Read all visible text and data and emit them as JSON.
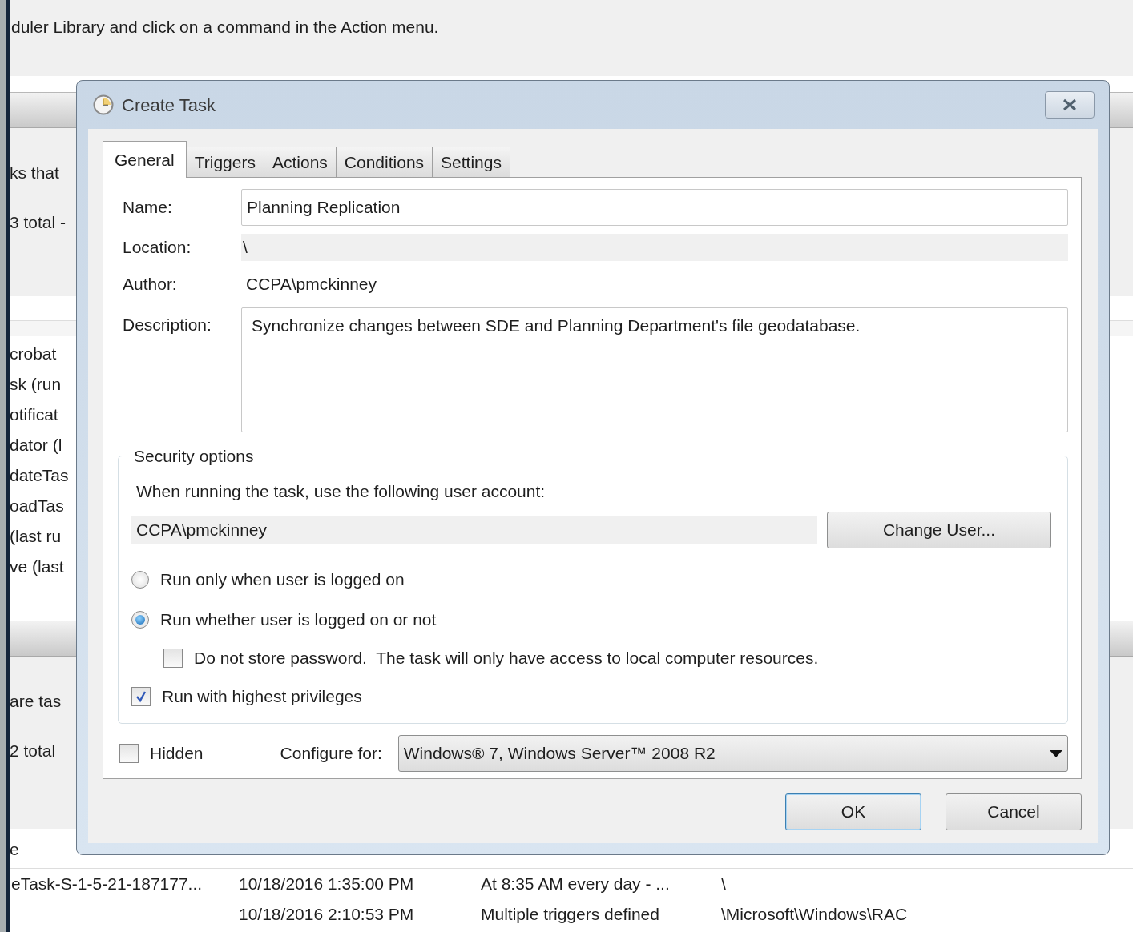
{
  "background": {
    "intro": "duler Library and click on a command in the Action menu.",
    "panel_1": {
      "lines": [
        "ks that",
        "3 total -"
      ]
    },
    "list_items": [
      "crobat",
      "sk (run",
      "otificat",
      "dator (l",
      "dateTas",
      "oadTas",
      "(last ru",
      "ve (last"
    ],
    "panel_2": {
      "lines": [
        "are tas",
        "2 total"
      ]
    },
    "table": {
      "columns": [
        "e"
      ],
      "rows": [
        {
          "column_1": "eTask-S-1-5-21-187177...",
          "column_2": "10/18/2016 1:35:00 PM",
          "column_3": "At 8:35 AM every day - ...",
          "column_4": "\\"
        },
        {
          "column_2": "10/18/2016 2:10:53 PM",
          "column_3": "Multiple triggers defined",
          "column_4": "\\Microsoft\\Windows\\RAC"
        }
      ]
    }
  },
  "dialog": {
    "title": "Create Task",
    "tabs": [
      {
        "label": "General",
        "selected": true
      },
      {
        "label": "Triggers",
        "selected": false
      },
      {
        "label": "Actions",
        "selected": false
      },
      {
        "label": "Conditions",
        "selected": false
      },
      {
        "label": "Settings",
        "selected": false
      }
    ],
    "fields": [
      {
        "kind": "input",
        "label": "Name:",
        "value": "Planning Replication"
      },
      {
        "kind": "readonly",
        "label": "Location:",
        "value": "\\"
      },
      {
        "kind": "text",
        "label": "Author:",
        "value": "CCPA\\pmckinney"
      },
      {
        "kind": "textarea",
        "label": "Description:",
        "value": "Synchronize changes between SDE and Planning Department's file geodatabase."
      }
    ],
    "security": {
      "title": "Security options",
      "account_prompt": "When running the task, use the following user account:",
      "account": "CCPA\\pmckinney",
      "change_user_button": "Change User...",
      "options": [
        {
          "kind": "radio",
          "label": "Run only when user is logged on",
          "selected": false
        },
        {
          "kind": "radio",
          "label": "Run whether user is logged on or not",
          "selected": true,
          "children": [
            {
              "kind": "checkbox",
              "label": "Do not store password.  The task will only have access to local computer resources.",
              "checked": false
            }
          ]
        },
        {
          "kind": "checkbox",
          "label": "Run with highest privileges",
          "checked": true
        }
      ]
    },
    "hidden": {
      "label": "Hidden",
      "checked": false
    },
    "configure": {
      "label": "Configure for:",
      "value": "Windows® 7, Windows Server™ 2008 R2"
    },
    "buttons": [
      {
        "label": "OK",
        "default": true
      },
      {
        "label": "Cancel",
        "default": false
      }
    ]
  }
}
